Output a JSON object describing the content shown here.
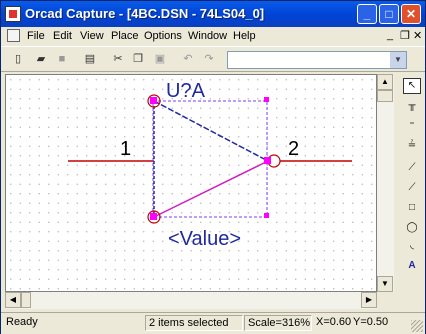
{
  "window": {
    "title": "Orcad Capture - [4BC.DSN - 74LS04_0]",
    "controls": {
      "minimize": "_",
      "maximize": "□",
      "close": "✕"
    }
  },
  "menubar": {
    "items": [
      "File",
      "Edit",
      "View",
      "Place",
      "Options",
      "Window",
      "Help"
    ],
    "mdi_controls": {
      "minimize": "_",
      "restore": "❐",
      "close": "✕"
    }
  },
  "toolbar": {
    "buttons": [
      {
        "name": "new-icon",
        "glyph": "▯"
      },
      {
        "name": "open-icon",
        "glyph": "▰"
      },
      {
        "name": "save-icon",
        "glyph": "■"
      },
      {
        "name": "print-icon",
        "glyph": "▤"
      },
      {
        "name": "cut-icon",
        "glyph": "✂"
      },
      {
        "name": "copy-icon",
        "glyph": "❐"
      },
      {
        "name": "paste-icon",
        "glyph": "▣"
      },
      {
        "name": "undo-icon",
        "glyph": "↶"
      },
      {
        "name": "redo-icon",
        "glyph": "↷"
      }
    ],
    "combo_value": ""
  },
  "part": {
    "reference": "U?A",
    "value": "<Value>",
    "pin_in": "1",
    "pin_out": "2",
    "colors": {
      "body": "#1f2a9c",
      "pin": "#c00000",
      "handle": "#ff00ff",
      "selection": "#7b3cff"
    }
  },
  "palette": {
    "tools": [
      {
        "name": "select-tool-icon",
        "glyph": "↖"
      },
      {
        "name": "place-pin-icon",
        "glyph": "╥"
      },
      {
        "name": "place-pin-array-icon",
        "glyph": "⁼"
      },
      {
        "name": "place-ieee-symbol-icon",
        "glyph": "≟"
      },
      {
        "name": "place-line-icon",
        "glyph": "⟋"
      },
      {
        "name": "place-polyline-icon",
        "glyph": "⟋"
      },
      {
        "name": "place-rectangle-icon",
        "glyph": "□"
      },
      {
        "name": "place-ellipse-icon",
        "glyph": "◯"
      },
      {
        "name": "place-arc-icon",
        "glyph": "◟"
      },
      {
        "name": "place-text-icon",
        "glyph": "A"
      }
    ]
  },
  "statusbar": {
    "state": "Ready",
    "selection": "2 items selected",
    "scale": "Scale=316%",
    "x": "X=0.60",
    "y": "Y=0.50"
  }
}
